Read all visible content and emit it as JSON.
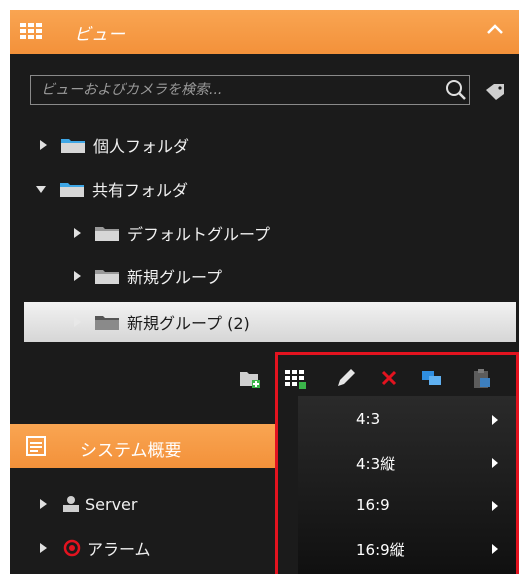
{
  "view_panel": {
    "title": "ビュー",
    "collapse_icon": "chevron-up-icon"
  },
  "search": {
    "placeholder": "ビューおよびカメラを検索...",
    "value": ""
  },
  "tree": {
    "personal_folder": "個人フォルダ",
    "shared_folder": "共有フォルダ",
    "default_group": "デフォルトグループ",
    "new_group": "新規グループ",
    "new_group_2": "新規グループ (2)"
  },
  "toolbar": {
    "icons": [
      "new-folder-icon",
      "new-view-icon",
      "edit-icon",
      "delete-icon",
      "copy-icon",
      "paste-icon"
    ]
  },
  "system_panel": {
    "title": "システム概要"
  },
  "system_tree": {
    "server": "Server",
    "alarm": "アラーム"
  },
  "layout_menu": {
    "items": [
      "4:3",
      "4:3縦",
      "16:9",
      "16:9縦"
    ]
  },
  "colors": {
    "accent": "#f39a44",
    "panel_bg": "#1b1b1b",
    "highlight": "#e3131f"
  }
}
